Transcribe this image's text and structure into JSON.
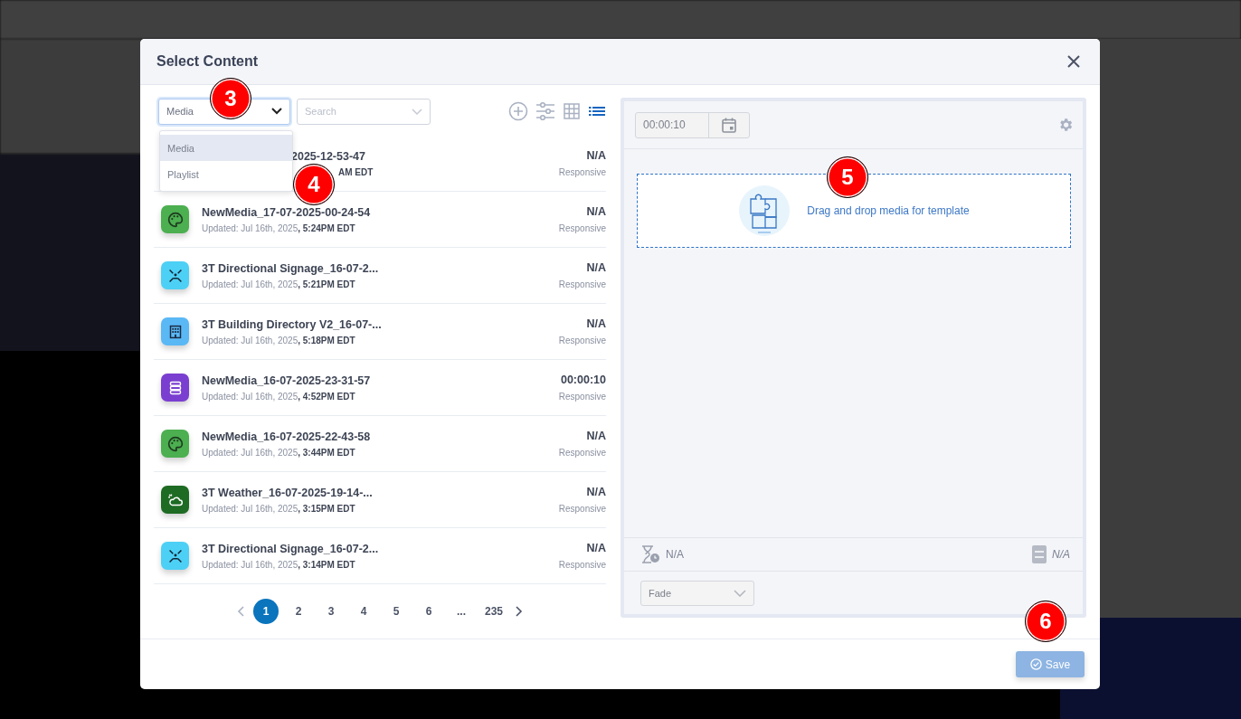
{
  "modal": {
    "title": "Select Content",
    "type_select": {
      "value": "Media",
      "options": [
        {
          "label": "Media",
          "selected": true
        },
        {
          "label": "Playlist",
          "selected": false
        }
      ]
    },
    "search": {
      "placeholder": "Search"
    },
    "views": [
      {
        "kind": "grid",
        "selected": false
      },
      {
        "kind": "list",
        "selected": true
      }
    ],
    "rows": [
      {
        "kind": "covered",
        "title": "2025-12-53-47",
        "date": "",
        "time": "AM EDT",
        "duration": "N/A",
        "layout": "Responsive"
      },
      {
        "kind": "palette",
        "color": "#4caf50",
        "title": "NewMedia_17-07-2025-00-24-54",
        "date": "Updated: Jul 16th, 2025",
        "time": ", 5:24PM EDT",
        "duration": "N/A",
        "layout": "Responsive"
      },
      {
        "kind": "arrows",
        "color": "#4dd0f5",
        "title": "3T Directional Signage_16-07-2...",
        "date": "Updated: Jul 16th, 2025",
        "time": ", 5:21PM EDT",
        "duration": "N/A",
        "layout": "Responsive"
      },
      {
        "kind": "building",
        "color": "#5ab8f5",
        "title": "3T Building Directory V2_16-07-...",
        "date": "Updated: Jul 16th, 2025",
        "time": ", 5:18PM EDT",
        "duration": "N/A",
        "layout": "Responsive"
      },
      {
        "kind": "stack",
        "color": "#7a3fd0",
        "title": "NewMedia_16-07-2025-23-31-57",
        "date": "Updated: Jul 16th, 2025",
        "time": ", 4:52PM EDT",
        "duration": "00:00:10",
        "layout": "Responsive"
      },
      {
        "kind": "palette",
        "color": "#4caf50",
        "title": "NewMedia_16-07-2025-22-43-58",
        "date": "Updated: Jul 16th, 2025",
        "time": ", 3:44PM EDT",
        "duration": "N/A",
        "layout": "Responsive"
      },
      {
        "kind": "weather",
        "color": "#1e6b24",
        "title": "3T Weather_16-07-2025-19-14-...",
        "date": "Updated: Jul 16th, 2025",
        "time": ", 3:15PM EDT",
        "duration": "N/A",
        "layout": "Responsive"
      },
      {
        "kind": "arrows",
        "color": "#4dd0f5",
        "title": "3T Directional Signage_16-07-2...",
        "date": "Updated: Jul 16th, 2025",
        "time": ", 3:14PM EDT",
        "duration": "N/A",
        "layout": "Responsive"
      }
    ],
    "pages": [
      {
        "label": "1",
        "selected": true
      },
      {
        "label": "2",
        "selected": false
      },
      {
        "label": "3",
        "selected": false
      },
      {
        "label": "4",
        "selected": false
      },
      {
        "label": "5",
        "selected": false
      },
      {
        "label": "6",
        "selected": false
      },
      {
        "label": "...",
        "selected": false
      },
      {
        "label": "235",
        "selected": false
      }
    ],
    "editor": {
      "duration": "00:00:10",
      "drop_text": "Drag and drop media for template",
      "play_time": "N/A",
      "size": "N/A",
      "transition": "Fade"
    },
    "save": {
      "label": "Save",
      "disabled": true
    }
  },
  "callouts": [
    "3",
    "4",
    "5",
    "6"
  ]
}
